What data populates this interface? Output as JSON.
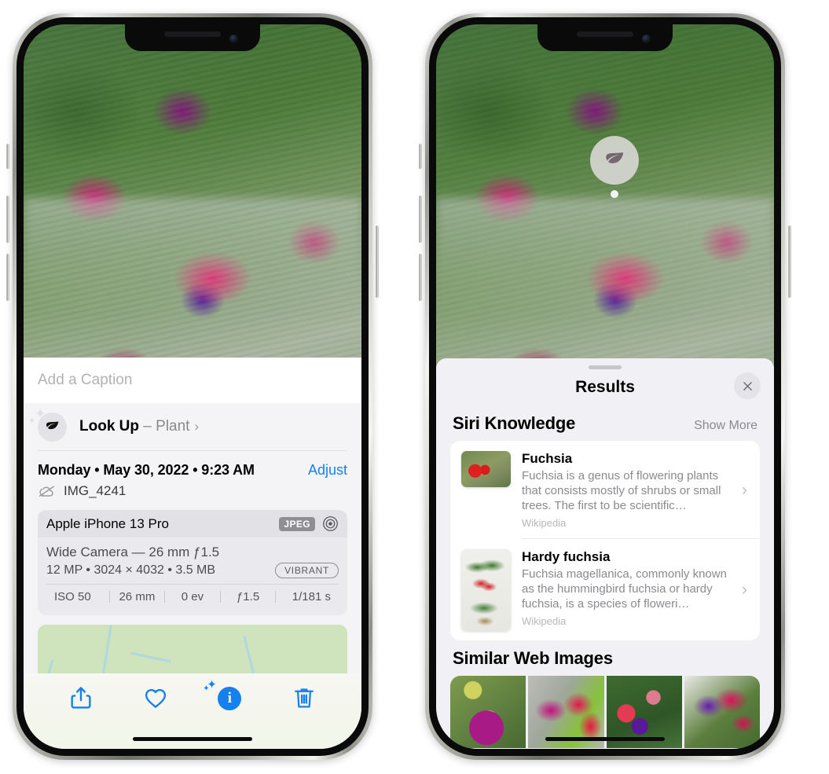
{
  "left_phone": {
    "name": "photos-detail-view",
    "caption": {
      "placeholder": "Add a Caption",
      "value": ""
    },
    "lookup_row": {
      "label": "Look Up",
      "dash": "–",
      "subject": "Plant",
      "chevron": "›",
      "icon": "leaf-icon"
    },
    "date": "Monday • May 30, 2022 • 9:23 AM",
    "adjust_label": "Adjust",
    "filename": "IMG_4241",
    "cloud_icon": "cloud-slash-icon",
    "metadata": {
      "device": "Apple iPhone 13 Pro",
      "format_badge": "JPEG",
      "aperture_icon": "aperture-icon",
      "lens_line": "Wide Camera — 26 mm ƒ1.5",
      "size_line": "12 MP • 3024 × 4032 • 3.5 MB",
      "style_badge": "VIBRANT",
      "exif": [
        "ISO 50",
        "26 mm",
        "0 ev",
        "ƒ1.5",
        "1/181 s"
      ]
    },
    "tabbar": [
      {
        "name": "share-button",
        "icon": "share-icon"
      },
      {
        "name": "favorite-button",
        "icon": "heart-icon"
      },
      {
        "name": "info-button",
        "icon": "info-sparkle-icon",
        "glyph": "i"
      },
      {
        "name": "delete-button",
        "icon": "trash-icon"
      }
    ],
    "accent_color": "#1581ef"
  },
  "right_phone": {
    "name": "visual-look-up-results",
    "vlu_badge": {
      "icon": "leaf-icon"
    },
    "sheet": {
      "title": "Results",
      "close_icon": "close-icon",
      "sections": [
        {
          "title": "Siri Knowledge",
          "action": "Show More",
          "items": [
            {
              "title": "Fuchsia",
              "description": "Fuchsia is a genus of flowering plants that consists mostly of shrubs or small trees. The first to be scientific…",
              "source": "Wikipedia",
              "chevron": "›"
            },
            {
              "title": "Hardy fuchsia",
              "description": "Fuchsia magellanica, commonly known as the hummingbird fuchsia or hardy fuchsia, is a species of floweri…",
              "source": "Wikipedia",
              "chevron": "›"
            }
          ]
        },
        {
          "title": "Similar Web Images",
          "images_count": 4
        }
      ]
    }
  }
}
